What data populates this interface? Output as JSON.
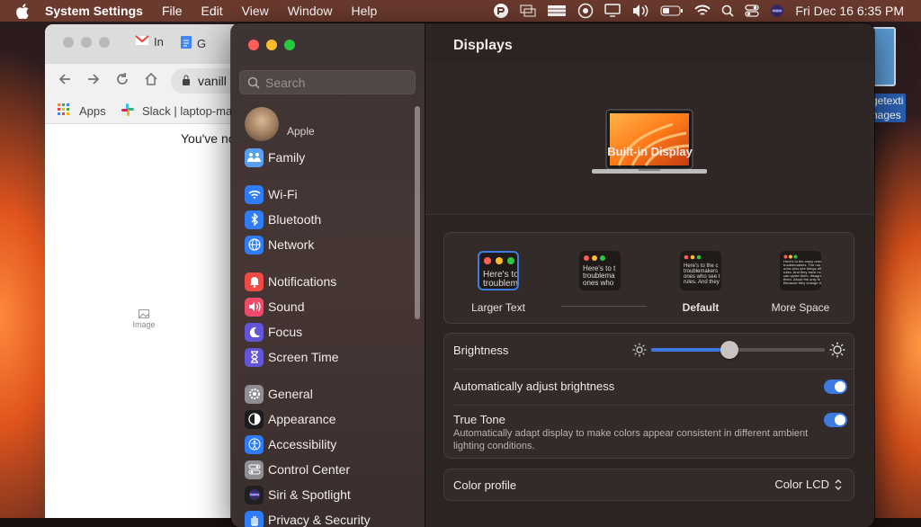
{
  "menubar": {
    "app_name": "System Settings",
    "menus": [
      "File",
      "Edit",
      "View",
      "Window",
      "Help"
    ],
    "clock": "Fri Dec 16  6:35 PM",
    "status_icons": [
      "pocket-icon",
      "display-mirror-icon",
      "drive-icon",
      "screen-time-icon",
      "monitor-icon",
      "volume-icon",
      "battery-icon",
      "wifi-icon",
      "search-icon",
      "control-center-icon",
      "siri-icon"
    ]
  },
  "browser": {
    "tab1": "In",
    "tab2": "G",
    "url": "vanill",
    "bookmark1": "Apps",
    "bookmark2": "Slack | laptop-ma",
    "page_text": "You've no",
    "image_alt": "Image"
  },
  "desktop": {
    "file_label_1": "getexti",
    "file_label_2": "nages"
  },
  "sidebar": {
    "search_placeholder": "Search",
    "account_label": "Apple",
    "items": [
      {
        "label": "Family",
        "icon": "family-icon",
        "color": "#5aa0f0"
      },
      {
        "label": "Wi-Fi",
        "icon": "wifi-icon",
        "color": "#2f7cf6"
      },
      {
        "label": "Bluetooth",
        "icon": "bluetooth-icon",
        "color": "#2f7cf6"
      },
      {
        "label": "Network",
        "icon": "globe-icon",
        "color": "#2f7cf6"
      },
      {
        "label": "Notifications",
        "icon": "bell-icon",
        "color": "#ee4b45"
      },
      {
        "label": "Sound",
        "icon": "speaker-icon",
        "color": "#ee4b6a"
      },
      {
        "label": "Focus",
        "icon": "moon-icon",
        "color": "#6355d8"
      },
      {
        "label": "Screen Time",
        "icon": "hourglass-icon",
        "color": "#6355d8"
      },
      {
        "label": "General",
        "icon": "gear-icon",
        "color": "#8e8e93"
      },
      {
        "label": "Appearance",
        "icon": "appearance-icon",
        "color": "#1c1c1e"
      },
      {
        "label": "Accessibility",
        "icon": "accessibility-icon",
        "color": "#2f7cf6"
      },
      {
        "label": "Control Center",
        "icon": "control-center-icon",
        "color": "#8e8e93"
      },
      {
        "label": "Siri & Spotlight",
        "icon": "siri-icon",
        "color": "#202020"
      },
      {
        "label": "Privacy & Security",
        "icon": "hand-icon",
        "color": "#2f7cf6"
      }
    ]
  },
  "main": {
    "title": "Displays",
    "display_name": "Built-in Display",
    "resolution_options": [
      {
        "label": "Larger Text",
        "sample": "Here's to\ntroublem",
        "selected": true
      },
      {
        "label": "",
        "sample": "Here's to t\ntroublema\nones who",
        "selected": false
      },
      {
        "label": "Default",
        "sample": "Here's to the c\ntroublemakers\nones who see t\nrules. And they",
        "selected": false
      },
      {
        "label": "More Space",
        "sample": "Here's to the crazy ones\ntroublemakers. The rou\nones who see things dif\nrules. And they have no\ncan quote them, disagre\nthem. About the only th\nBecause they change th",
        "selected": false
      }
    ],
    "brightness_label": "Brightness",
    "brightness_value": 0.45,
    "auto_brightness_label": "Automatically adjust brightness",
    "auto_brightness_on": true,
    "true_tone_label": "True Tone",
    "true_tone_desc": "Automatically adapt display to make colors appear consistent in different ambient lighting conditions.",
    "true_tone_on": true,
    "color_profile_label": "Color profile",
    "color_profile_value": "Color LCD"
  },
  "colors": {
    "accent": "#3d7be0",
    "window_bg": "#2b2422",
    "sidebar_bg": "#3d3433"
  }
}
